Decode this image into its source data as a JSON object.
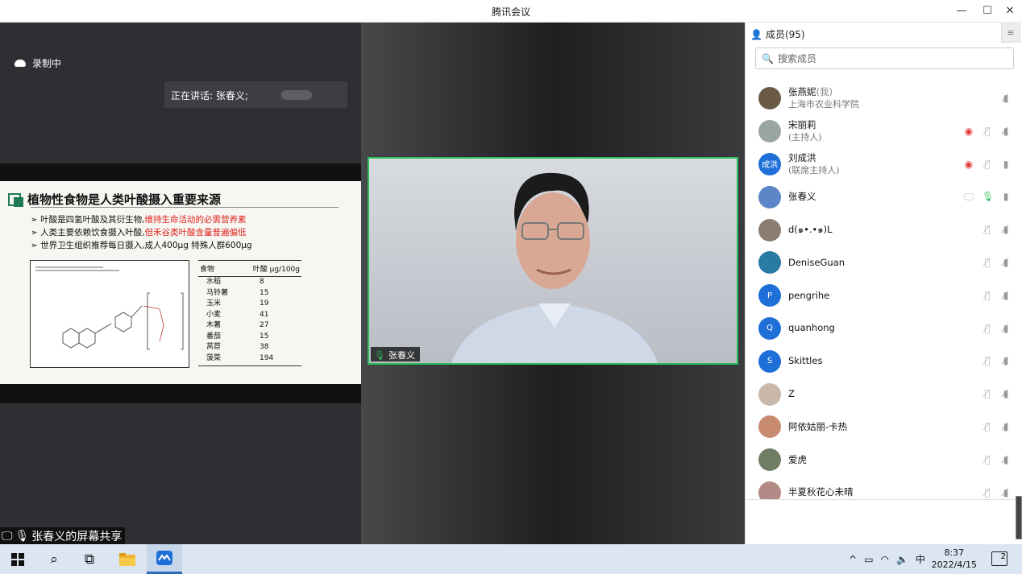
{
  "window": {
    "title": "腾讯会议",
    "minimize": "—",
    "maximize": "☐",
    "close": "✕"
  },
  "share": {
    "recording_label": "录制中",
    "speaking_label": "正在讲话: 张春义;",
    "footer_label": "张春义的屏幕共享"
  },
  "slide": {
    "title": "植物性食物是人类叶酸摄入重要来源",
    "bullets": [
      {
        "text": "叶酸是四氢叶酸及其衍生物,",
        "highlight": "维持生命活动的必需营养素"
      },
      {
        "text": "人类主要依赖饮食摄入叶酸,",
        "highlight": "但禾谷类叶酸含量普遍偏低"
      },
      {
        "text": "世界卫生组织推荐每日摄入,成人400μg 特殊人群600μg",
        "highlight": ""
      }
    ],
    "table": {
      "col1": "食物",
      "col2": "叶酸 μg/100g",
      "rows": [
        {
          "name": "水稻",
          "value": "8"
        },
        {
          "name": "马铃薯",
          "value": "15"
        },
        {
          "name": "玉米",
          "value": "19"
        },
        {
          "name": "小麦",
          "value": "41"
        },
        {
          "name": "木薯",
          "value": "27"
        },
        {
          "name": "番茄",
          "value": "15"
        },
        {
          "name": "莴苣",
          "value": "38"
        },
        {
          "name": "菠菜",
          "value": "194"
        }
      ]
    }
  },
  "video": {
    "participant_name": "张春义"
  },
  "panel": {
    "header": "成员(95)",
    "search_placeholder": "搜索成员",
    "members": [
      {
        "name": "张燕妮",
        "suffix": "(我)",
        "sub": "上海市农业科学院",
        "avatar": "#6b5a48",
        "initials": "",
        "icons": [
          "video-off-icon"
        ]
      },
      {
        "name": "宋丽莉",
        "suffix": "",
        "sub": "(主持人)",
        "avatar": "#9aa7a0",
        "initials": "",
        "icons": [
          "eye-icon",
          "mic-off-icon",
          "video-off-icon"
        ]
      },
      {
        "name": "刘成洪",
        "suffix": "",
        "sub": "(联席主持人)",
        "avatar": "#1f6fd8",
        "initials": "成洪",
        "icons": [
          "eye-icon",
          "mic-off-icon",
          "video-on-icon"
        ]
      },
      {
        "name": "张春义",
        "suffix": "",
        "sub": "",
        "avatar": "#5c86c7",
        "initials": "",
        "icons": [
          "screen-share-icon",
          "mic-on-icon",
          "video-on-icon"
        ]
      },
      {
        "name": "d(๑•.•๑)L",
        "suffix": "",
        "sub": "",
        "avatar": "#8a7c6f",
        "initials": "",
        "icons": [
          "mic-off-icon",
          "video-off-icon"
        ]
      },
      {
        "name": "DeniseGuan",
        "suffix": "",
        "sub": "",
        "avatar": "#2a7ba4",
        "initials": "",
        "icons": [
          "mic-off-icon",
          "video-off-icon"
        ]
      },
      {
        "name": "pengrihe",
        "suffix": "",
        "sub": "",
        "avatar": "#1f6fd8",
        "initials": "P",
        "icons": [
          "mic-off-icon",
          "video-off-icon"
        ]
      },
      {
        "name": "quanhong",
        "suffix": "",
        "sub": "",
        "avatar": "#1f6fd8",
        "initials": "Q",
        "icons": [
          "mic-off-icon",
          "video-off-icon"
        ]
      },
      {
        "name": "Skittles",
        "suffix": "",
        "sub": "",
        "avatar": "#1f6fd8",
        "initials": "S",
        "icons": [
          "mic-off-icon",
          "video-off-icon"
        ]
      },
      {
        "name": "Z",
        "suffix": "",
        "sub": "",
        "avatar": "#c9b8a9",
        "initials": "",
        "icons": [
          "mic-off-icon",
          "video-off-icon"
        ]
      },
      {
        "name": "阿依姑丽-卡热",
        "suffix": "",
        "sub": "",
        "avatar": "#c98b6f",
        "initials": "",
        "icons": [
          "mic-off-icon",
          "video-off-icon"
        ]
      },
      {
        "name": "爱虎",
        "suffix": "",
        "sub": "",
        "avatar": "#6e7d63",
        "initials": "",
        "icons": [
          "mic-off-icon",
          "video-off-icon"
        ]
      },
      {
        "name": "半夏秋花心未晴",
        "suffix": "",
        "sub": "",
        "avatar": "#b58a86",
        "initials": "",
        "icons": [
          "mic-off-icon",
          "video-off-icon"
        ]
      }
    ]
  },
  "taskbar": {
    "tray_chevron": "^",
    "ime": "中",
    "time": "8:37",
    "date": "2022/4/15",
    "notifications": "2"
  },
  "colors": {
    "accent": "#2bbf5c",
    "brand_blue": "#1f6fd8",
    "highlight_red": "#e0201a"
  }
}
